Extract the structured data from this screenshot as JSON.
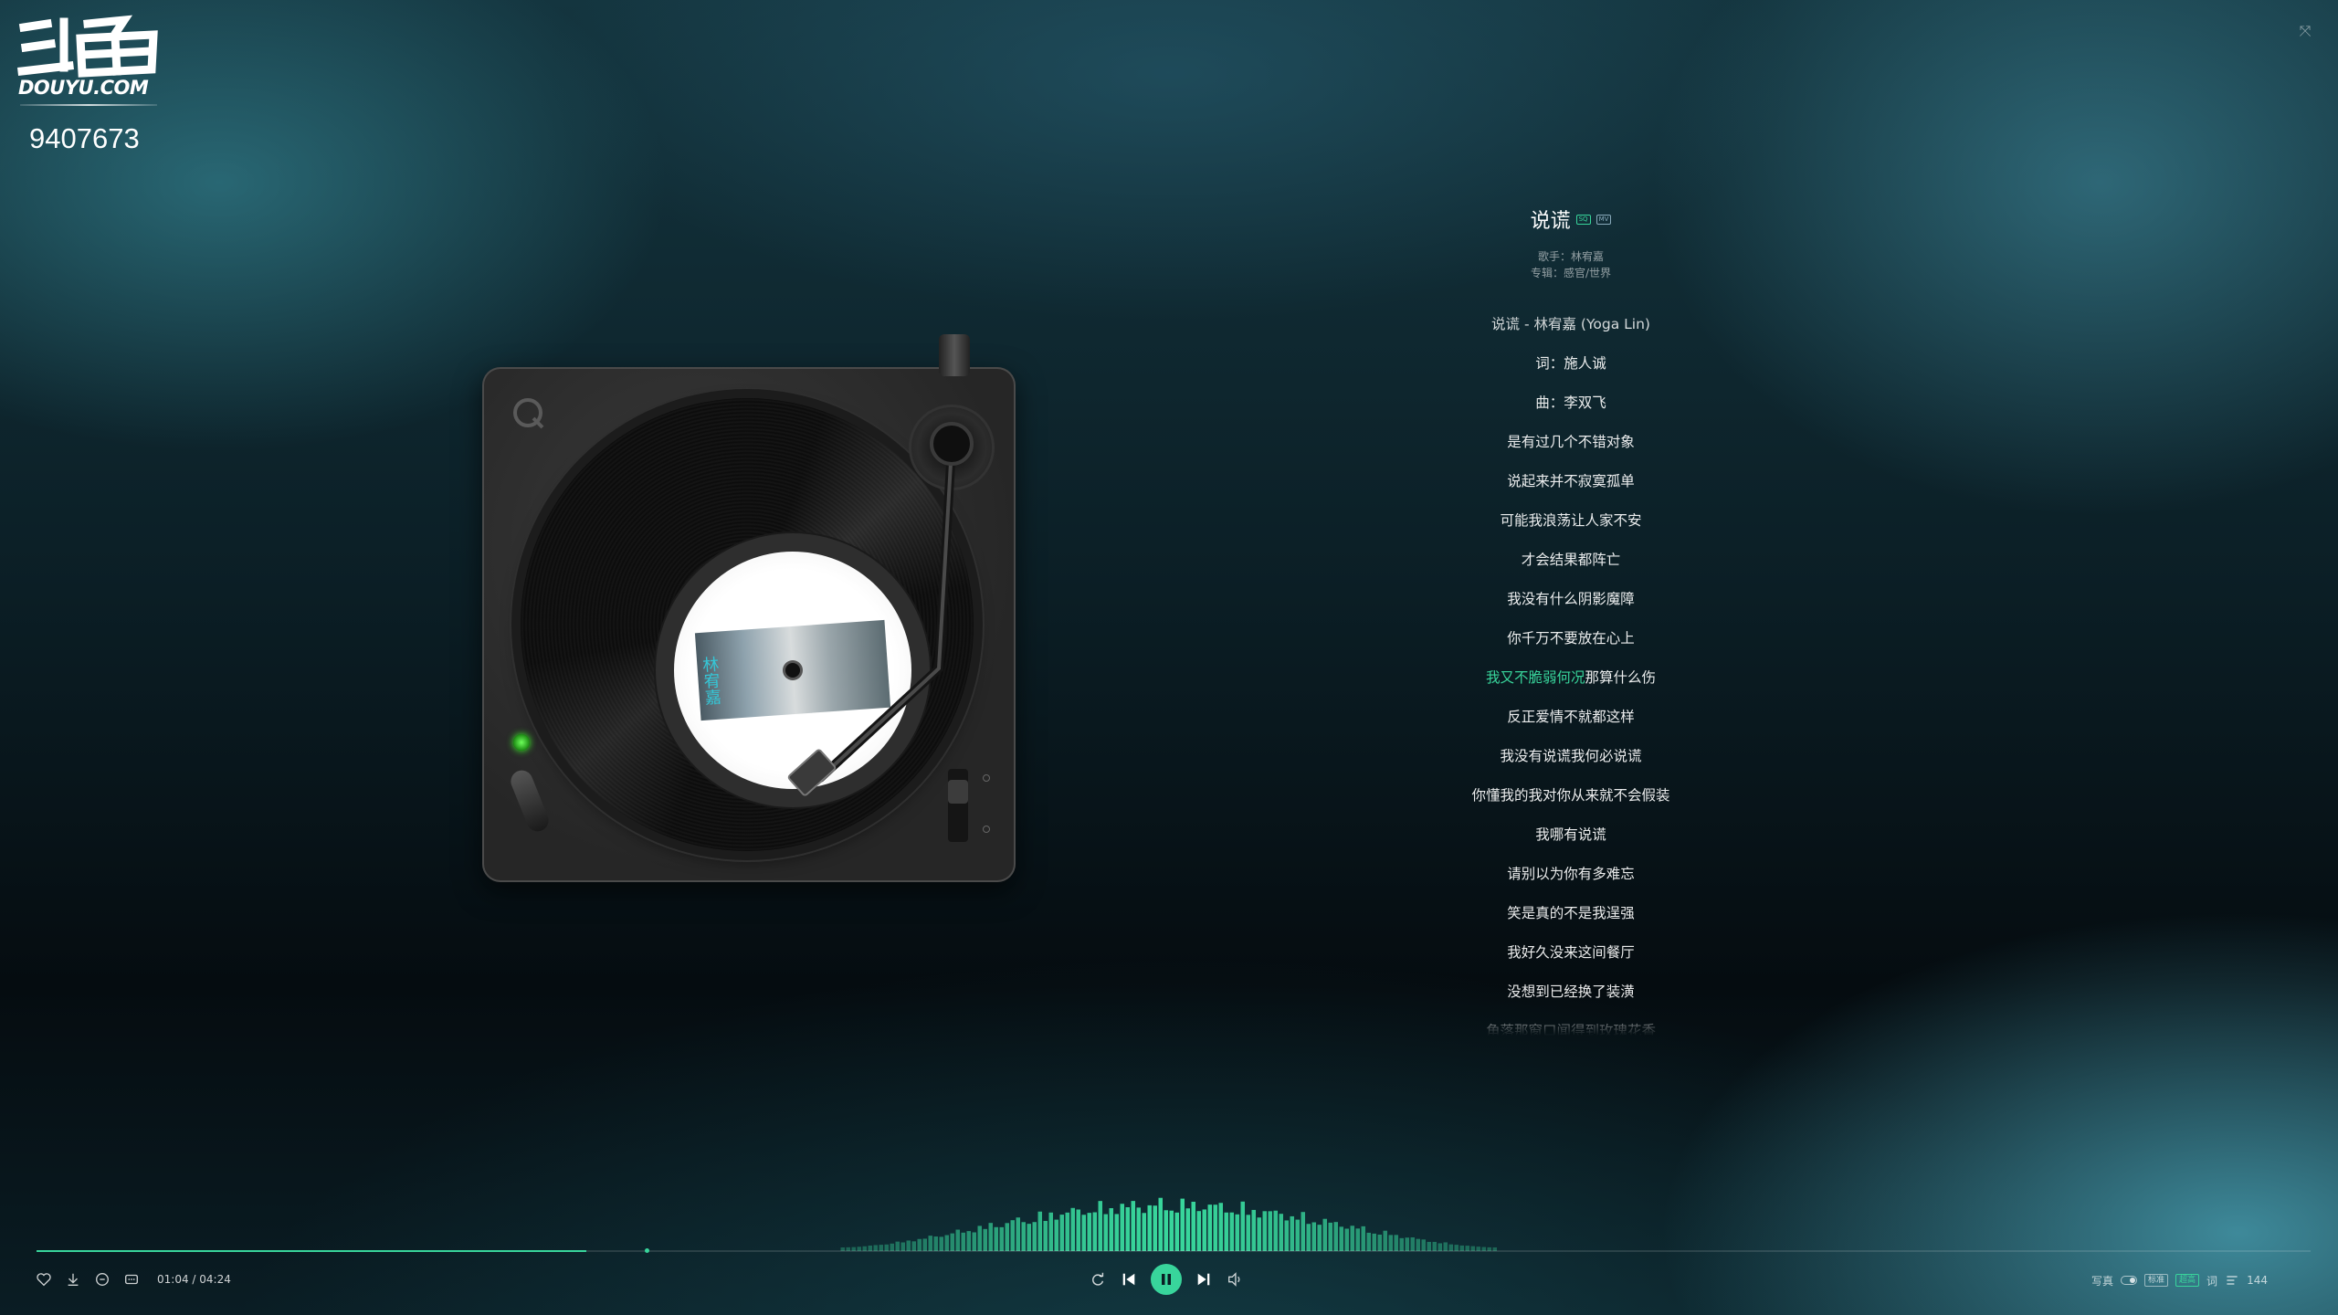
{
  "logo": {
    "domain": "DOUYU.COM"
  },
  "room": {
    "id": "9407673"
  },
  "song": {
    "title": "说谎",
    "tag_sq": "SQ",
    "tag_mv": "MV",
    "singer_line": "歌手：林宥嘉",
    "album_line": "专辑：感官/世界"
  },
  "album_cover": {
    "text": "林宥嘉"
  },
  "lyrics": [
    "说谎 - 林宥嘉 (Yoga Lin)",
    "词：施人诚",
    "曲：李双飞",
    "是有过几个不错对象",
    "说起来并不寂寞孤单",
    "可能我浪荡让人家不安",
    "才会结果都阵亡",
    "我没有什么阴影魔障",
    "你千万不要放在心上",
    "我又不脆弱何况",
    "反正爱情不就都这样",
    "我没有说谎我何必说谎",
    "你懂我的我对你从来就不会假装",
    "我哪有说谎",
    "请别以为你有多难忘",
    "笑是真的不是我逞强",
    "我好久没来这间餐厅",
    "没想到已经换了装潢",
    "角落那窗口闻得到玫瑰花香"
  ],
  "current_lyric": {
    "highlight": "我又不脆弱何况",
    "rest": "那算什么伤"
  },
  "playback": {
    "time_display": "01:04 / 04:24",
    "progress": 0.2417
  },
  "right_controls": {
    "photo_label": "写真",
    "quality_standard": "标准",
    "quality_hq": "超高",
    "lyric_label": "词",
    "playlist_count": "144"
  },
  "accent_color": "#38d59b",
  "icons": [
    "heart-icon",
    "download-icon",
    "comment-icon",
    "more-icon",
    "loop-icon",
    "prev-icon",
    "pause-icon",
    "next-icon",
    "volume-icon",
    "playlist-icon"
  ]
}
